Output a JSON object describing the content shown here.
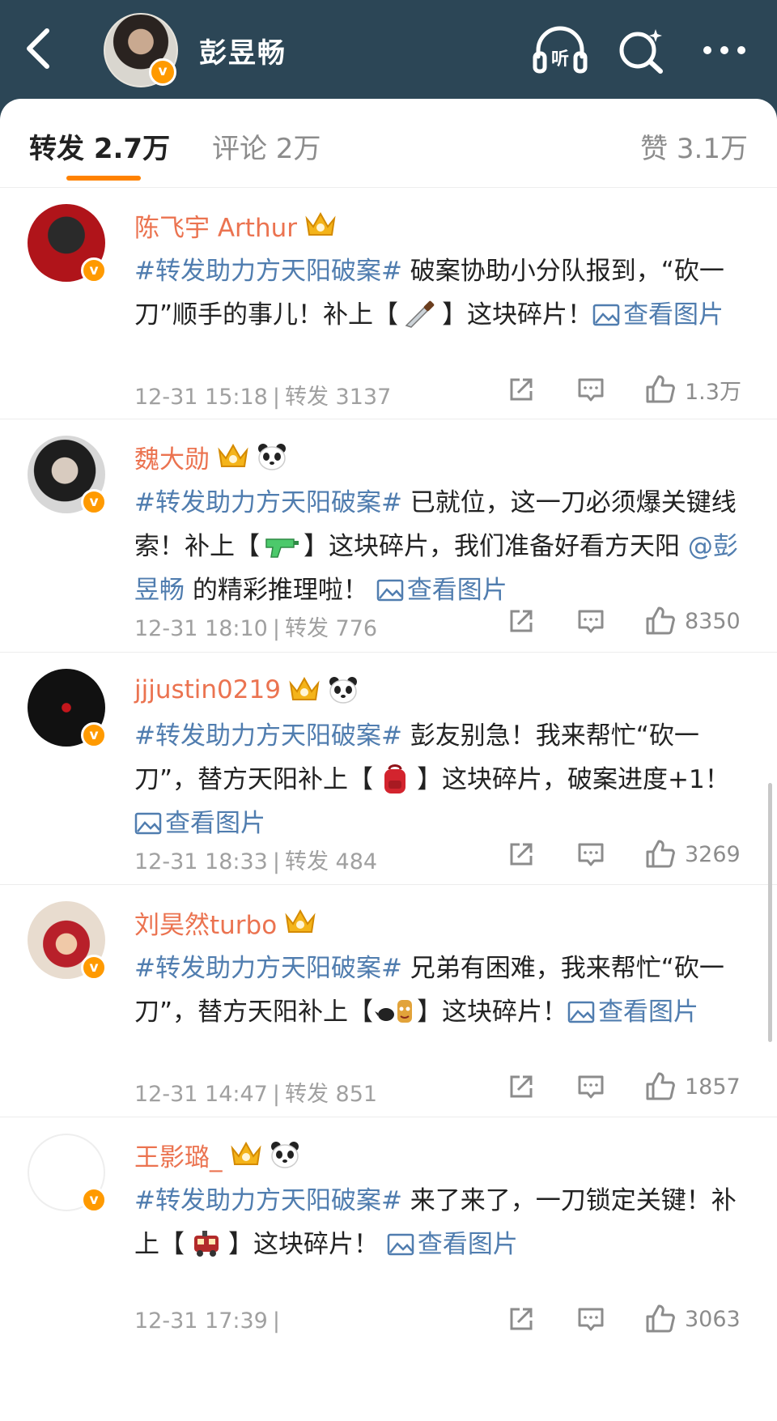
{
  "header": {
    "title": "彭昱畅",
    "listen_label": "听",
    "verified_mark": "v"
  },
  "tabs": {
    "repost": "转发 2.7万",
    "comment": "评论 2万",
    "like": "赞 3.1万"
  },
  "colors": {
    "header_bg": "#2c4656",
    "accent_orange": "#ff8200",
    "username": "#eb7350",
    "link_blue": "#507daf"
  },
  "posts": [
    {
      "name": "陈飞宇 Arthur",
      "panda": false,
      "hashtag": "#转发助力方天阳破案#",
      "text1": " 破案协助小分队报到，“砍一刀”顺手的事儿！补上【",
      "emoji": "knife",
      "text2": "】这块碎片！",
      "mention": "",
      "text3": "",
      "view_image": "查看图片",
      "time": "12-31 15:18",
      "repost": "转发 3137",
      "likes": "1.3万"
    },
    {
      "name": "魏大勋",
      "panda": true,
      "hashtag": "#转发助力方天阳破案#",
      "text1": " 已就位，这一刀必须爆关键线索！补上【",
      "emoji": "water-gun",
      "text2": "】这块碎片，我们准备好看方天阳 ",
      "mention": "@彭昱畅",
      "text3": " 的精彩推理啦！ ",
      "view_image": "查看图片",
      "time": "12-31 18:10",
      "repost": "转发 776",
      "likes": "8350"
    },
    {
      "name": "jjjustin0219",
      "panda": true,
      "hashtag": "#转发助力方天阳破案#",
      "text1": " 彭友别急！我来帮忙“砍一刀”，替方天阳补上【",
      "emoji": "backpack",
      "text2": "】这块碎片，破案进度+1！ ",
      "mention": "",
      "text3": "",
      "view_image": "查看图片",
      "time": "12-31 18:33",
      "repost": "转发 484",
      "likes": "3269"
    },
    {
      "name": "刘昊然turbo",
      "panda": false,
      "hashtag": "#转发助力方天阳破案#",
      "text1": " 兄弟有困难，我来帮忙“砍一刀”，替方天阳补上【",
      "emoji": "crow-mask",
      "text2": "】这块碎片！",
      "mention": "",
      "text3": "",
      "view_image": "查看图片",
      "time": "12-31 14:47",
      "repost": "转发 851",
      "likes": "1857"
    },
    {
      "name": "王影璐_",
      "panda": true,
      "hashtag": "#转发助力方天阳破案#",
      "text1": " 来了来了，一刀锁定关键！补上【",
      "emoji": "train",
      "text2": "】这块碎片！ ",
      "mention": "",
      "text3": "",
      "view_image": "查看图片",
      "time": "12-31 17:39",
      "repost": "",
      "likes": "3063"
    }
  ]
}
